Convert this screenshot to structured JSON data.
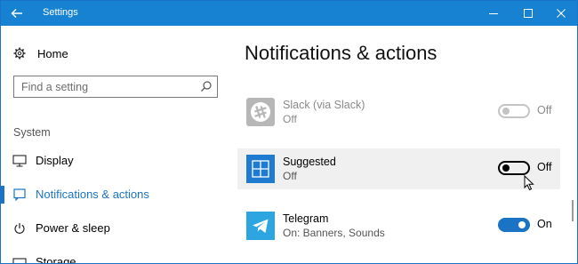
{
  "window": {
    "title": "Settings"
  },
  "colors": {
    "accent": "#1a73c4",
    "titlebar": "#1781d2",
    "telegram": "#2ca5e0",
    "suggested": "#1e7bd0",
    "slack_gray": "#7d7d7d"
  },
  "sidebar": {
    "home_label": "Home",
    "search": {
      "placeholder": "Find a setting"
    },
    "group_label": "System",
    "items": [
      {
        "label": "Display",
        "icon": "monitor-icon",
        "active": false
      },
      {
        "label": "Notifications & actions",
        "icon": "notification-icon",
        "active": true
      },
      {
        "label": "Power & sleep",
        "icon": "power-icon",
        "active": false
      },
      {
        "label": "Storage",
        "icon": "storage-icon",
        "active": false
      }
    ]
  },
  "main": {
    "title": "Notifications & actions",
    "apps": [
      {
        "name": "Slack (via Slack)",
        "status": "Off",
        "toggle": "Off",
        "toggle_on": false,
        "enabled": false,
        "icon": "slack-icon"
      },
      {
        "name": "Suggested",
        "status": "Off",
        "toggle": "Off",
        "toggle_on": false,
        "enabled": true,
        "icon": "suggested-icon"
      },
      {
        "name": "Telegram",
        "status": "On: Banners, Sounds",
        "toggle": "On",
        "toggle_on": true,
        "enabled": true,
        "icon": "telegram-icon"
      }
    ]
  }
}
